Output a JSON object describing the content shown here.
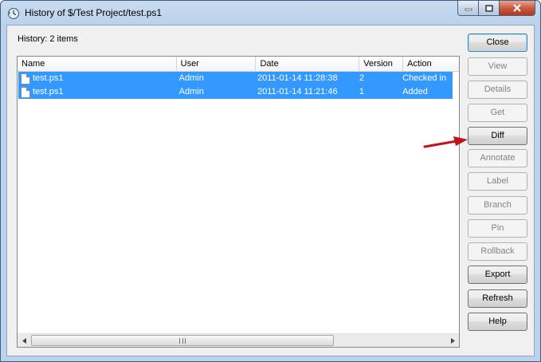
{
  "window": {
    "title": "History of $/Test Project/test.ps1"
  },
  "history_label": "History: 2 items",
  "columns": [
    "Name",
    "User",
    "Date",
    "Version",
    "Action"
  ],
  "rows": [
    {
      "name": "test.ps1",
      "user": "Admin",
      "date": "2011-01-14 11:28:38",
      "version": "2",
      "action": "Checked in"
    },
    {
      "name": "test.ps1",
      "user": "Admin",
      "date": "2011-01-14 11:21:46",
      "version": "1",
      "action": "Added"
    }
  ],
  "buttons": [
    {
      "label": "Close",
      "enabled": true
    },
    {
      "label": "View",
      "enabled": false
    },
    {
      "label": "Details",
      "enabled": false
    },
    {
      "label": "Get",
      "enabled": false
    },
    {
      "label": "Diff",
      "enabled": true
    },
    {
      "label": "Annotate",
      "enabled": false
    },
    {
      "label": "Label",
      "enabled": false
    },
    {
      "label": "Branch",
      "enabled": false
    },
    {
      "label": "Pin",
      "enabled": false
    },
    {
      "label": "Rollback",
      "enabled": false
    },
    {
      "label": "Export",
      "enabled": true
    },
    {
      "label": "Refresh",
      "enabled": true
    },
    {
      "label": "Help",
      "enabled": true
    }
  ],
  "colors": {
    "selection": "#3399ff",
    "arrow": "#c0141b"
  }
}
